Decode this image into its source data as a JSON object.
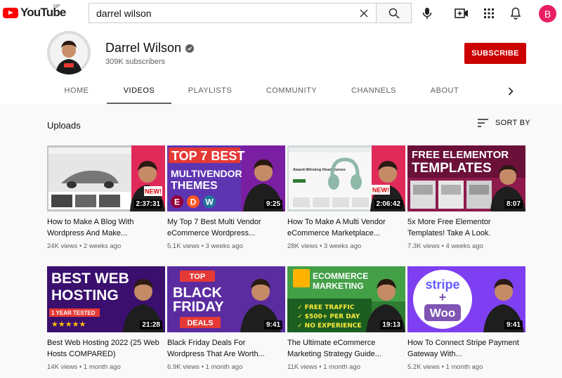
{
  "masthead": {
    "logo_text": "YouTube",
    "region": "NP",
    "search_value": "darrel wilson",
    "avatar_letter": "B",
    "icons": [
      "youtube-logo-icon",
      "clear-icon",
      "search-icon",
      "mic-icon",
      "create-video-icon",
      "apps-icon",
      "notifications-icon"
    ]
  },
  "channel": {
    "name": "Darrel Wilson",
    "subscribers": "309K subscribers",
    "subscribe_label": "SUBSCRIBE"
  },
  "tabs": [
    "HOME",
    "VIDEOS",
    "PLAYLISTS",
    "COMMUNITY",
    "CHANNELS",
    "ABOUT"
  ],
  "active_tab": "VIDEOS",
  "section": {
    "title": "Uploads",
    "sort_label": "SORT BY"
  },
  "videos": [
    {
      "title": "How to Make A Blog With Wordpress And Make...",
      "views": "24K views",
      "age": "2 weeks ago",
      "duration": "2:37:31",
      "thumb_text": [
        "NEW!"
      ]
    },
    {
      "title": "My Top 7 Best Multi Vendor eCommerce Wordpress...",
      "views": "5.1K views",
      "age": "3 weeks ago",
      "duration": "9:25",
      "thumb_text": [
        "TOP 7 BEST",
        "MULTIVENDOR",
        "THEMES"
      ]
    },
    {
      "title": "How To Make A Multi Vendor eCommerce Marketplace...",
      "views": "28K views",
      "age": "3 weeks ago",
      "duration": "2:06:42",
      "thumb_text": [
        "Award-Winning Headphones",
        "NEW!"
      ]
    },
    {
      "title": "5x More Free Elementor Templates! Take A Look.",
      "views": "7.3K views",
      "age": "4 weeks ago",
      "duration": "8:07",
      "thumb_text": [
        "FREE ELEMENTOR",
        "TEMPLATES"
      ]
    },
    {
      "title": "Best Web Hosting 2022 (25 Web Hosts COMPARED)",
      "views": "14K views",
      "age": "1 month ago",
      "duration": "21:28",
      "thumb_text": [
        "BEST WEB",
        "HOSTING",
        "1 YEAR TESTED"
      ]
    },
    {
      "title": "Black Friday Deals For Wordpress That Are Worth...",
      "views": "6.9K views",
      "age": "1 month ago",
      "duration": "9:41",
      "thumb_text": [
        "TOP",
        "BLACK",
        "FRIDAY",
        "DEALS"
      ]
    },
    {
      "title": "The Ultimate eCommerce Marketing Strategy Guide...",
      "views": "11K views",
      "age": "1 month ago",
      "duration": "19:13",
      "thumb_text": [
        "ECOMMERCE",
        "MARKETING",
        "✓ FREE TRAFFIC",
        "✓ $500+ PER DAY",
        "✓ NO EXPERIENCE"
      ]
    },
    {
      "title": "How To Connect Stripe Payment Gateway With...",
      "views": "5.2K views",
      "age": "1 month ago",
      "duration": "9:41",
      "thumb_text": [
        "stripe",
        "+",
        "Woo"
      ]
    }
  ],
  "colors": {
    "brand_red": "#ff0000",
    "subscribe_red": "#cc0000",
    "avatar_pink": "#e91e63"
  }
}
